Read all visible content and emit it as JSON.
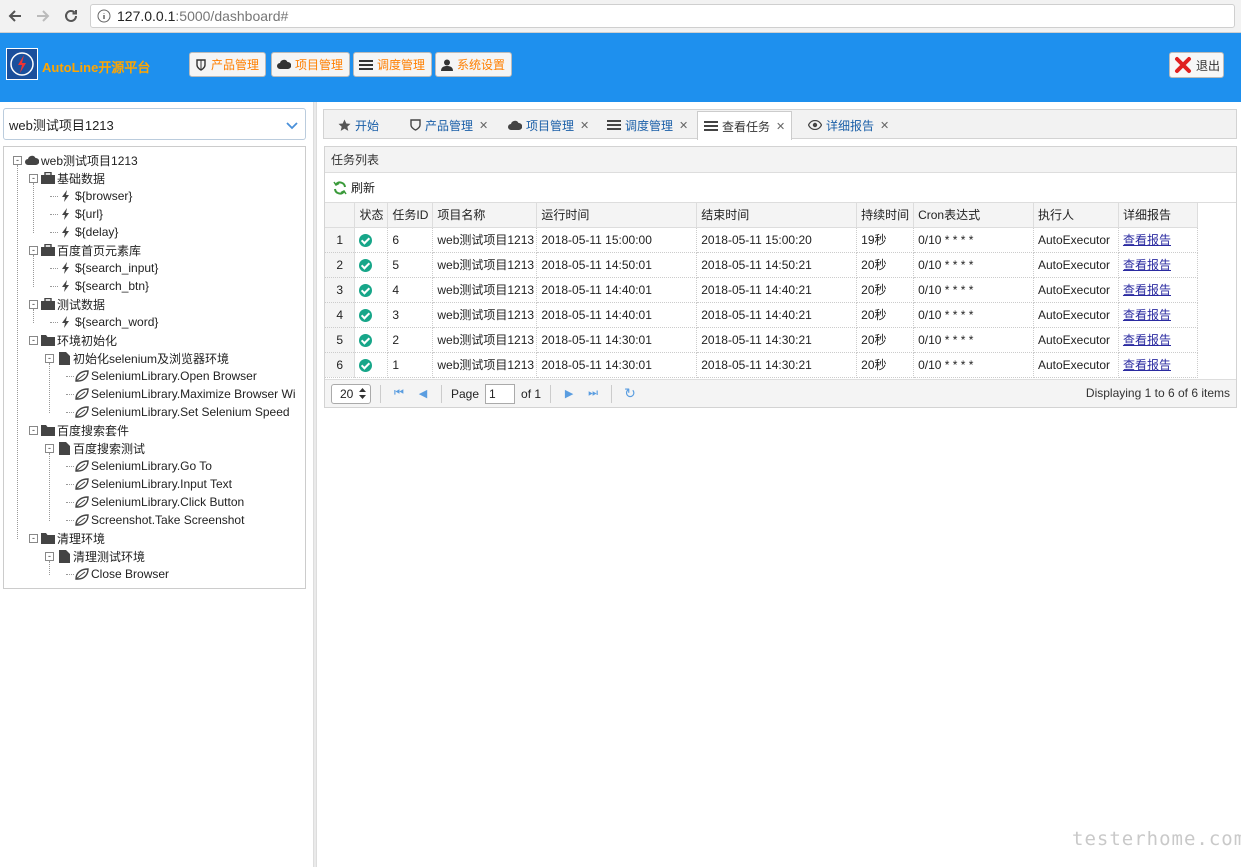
{
  "browser": {
    "host": "127.0.0.1",
    "path": ":5000/dashboard#"
  },
  "header": {
    "brand": "AutoLine开源平台",
    "buttons": [
      "产品管理",
      "项目管理",
      "调度管理",
      "系统设置"
    ],
    "logout": "退出",
    "colors": {
      "bar": "#1e90ee",
      "brand_text": "#ffa500"
    }
  },
  "sidebar": {
    "project_select": "web测试项目1213",
    "tree": [
      "web测试项目1213",
      "基础数据",
      "${browser}",
      "${url}",
      "${delay}",
      "百度首页元素库",
      "${search_input}",
      "${search_btn}",
      "测试数据",
      "${search_word}",
      "环境初始化",
      "初始化selenium及浏览器环境",
      "SeleniumLibrary.Open Browser",
      "SeleniumLibrary.Maximize Browser Wi",
      "SeleniumLibrary.Set Selenium Speed",
      "百度搜索套件",
      "百度搜索测试",
      "SeleniumLibrary.Go To",
      "SeleniumLibrary.Input Text",
      "SeleniumLibrary.Click Button",
      "Screenshot.Take Screenshot",
      "清理环境",
      "清理测试环境",
      "Close Browser"
    ]
  },
  "tabs": [
    "开始",
    "产品管理",
    "项目管理",
    "调度管理",
    "查看任务",
    "详细报告"
  ],
  "active_tab": "查看任务",
  "panel": {
    "title": "任务列表",
    "refresh": "刷新",
    "columns": [
      "状态",
      "任务ID",
      "项目名称",
      "运行时间",
      "结束时间",
      "持续时间",
      "Cron表达式",
      "执行人",
      "详细报告"
    ],
    "rows": [
      {
        "n": "1",
        "id": "6",
        "project": "web测试项目1213",
        "start": "2018-05-11 15:00:00",
        "end": "2018-05-11 15:00:20",
        "dur": "19秒",
        "cron": "0/10 * * * *",
        "user": "AutoExecutor",
        "report": "查看报告"
      },
      {
        "n": "2",
        "id": "5",
        "project": "web测试项目1213",
        "start": "2018-05-11 14:50:01",
        "end": "2018-05-11 14:50:21",
        "dur": "20秒",
        "cron": "0/10 * * * *",
        "user": "AutoExecutor",
        "report": "查看报告"
      },
      {
        "n": "3",
        "id": "4",
        "project": "web测试项目1213",
        "start": "2018-05-11 14:40:01",
        "end": "2018-05-11 14:40:21",
        "dur": "20秒",
        "cron": "0/10 * * * *",
        "user": "AutoExecutor",
        "report": "查看报告"
      },
      {
        "n": "4",
        "id": "3",
        "project": "web测试项目1213",
        "start": "2018-05-11 14:40:01",
        "end": "2018-05-11 14:40:21",
        "dur": "20秒",
        "cron": "0/10 * * * *",
        "user": "AutoExecutor",
        "report": "查看报告"
      },
      {
        "n": "5",
        "id": "2",
        "project": "web测试项目1213",
        "start": "2018-05-11 14:30:01",
        "end": "2018-05-11 14:30:21",
        "dur": "20秒",
        "cron": "0/10 * * * *",
        "user": "AutoExecutor",
        "report": "查看报告"
      },
      {
        "n": "6",
        "id": "1",
        "project": "web测试项目1213",
        "start": "2018-05-11 14:30:01",
        "end": "2018-05-11 14:30:21",
        "dur": "20秒",
        "cron": "0/10 * * * *",
        "user": "AutoExecutor",
        "report": "查看报告"
      }
    ],
    "pager": {
      "page_size": "20",
      "page_label": "Page",
      "page": "1",
      "of": "of 1",
      "info": "Displaying 1 to 6 of 6 items"
    }
  },
  "watermark": "testerhome.com"
}
